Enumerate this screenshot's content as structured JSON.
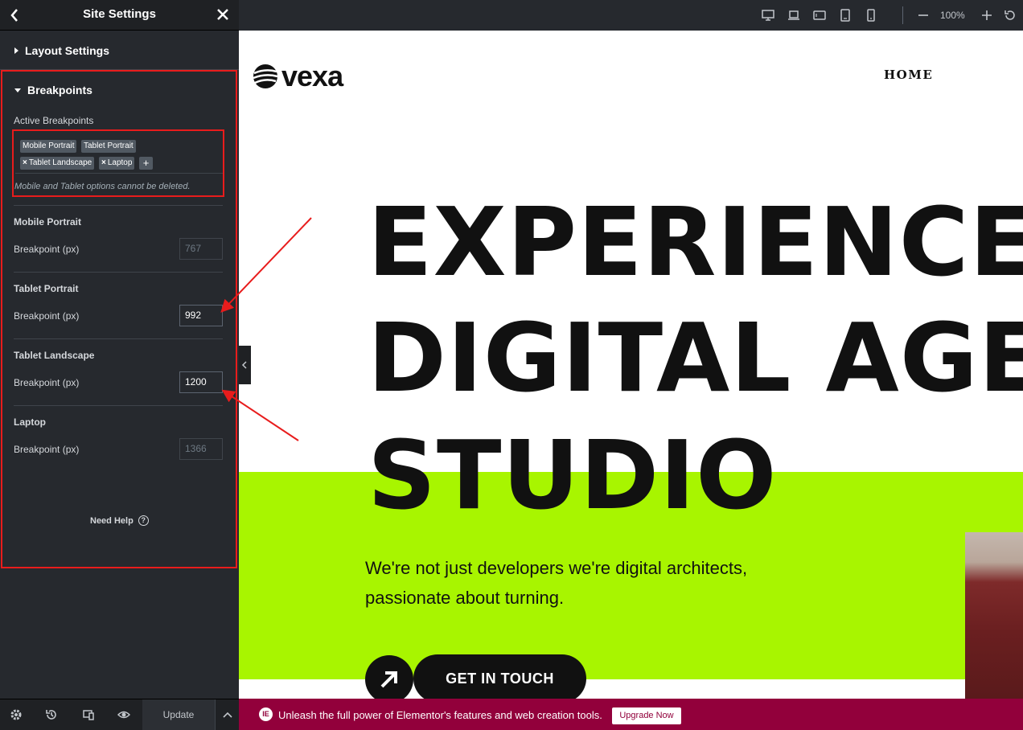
{
  "panel": {
    "title": "Site Settings",
    "layout_section": "Layout Settings",
    "breakpoints_section": "Breakpoints",
    "active_label": "Active Breakpoints",
    "tags": [
      "Mobile Portrait",
      "Tablet Portrait",
      "Tablet Landscape",
      "Laptop"
    ],
    "tag_remove_glyph": "×",
    "add_glyph": "+",
    "tags_note": "Mobile and Tablet options cannot be deleted.",
    "breakpoints": [
      {
        "title": "Mobile Portrait",
        "label": "Breakpoint (px)",
        "value": "767"
      },
      {
        "title": "Tablet Portrait",
        "label": "Breakpoint (px)",
        "value": "992"
      },
      {
        "title": "Tablet Landscape",
        "label": "Breakpoint (px)",
        "value": "1200"
      },
      {
        "title": "Laptop",
        "label": "Breakpoint (px)",
        "value": "1366"
      }
    ],
    "need_help": "Need Help",
    "help_glyph": "?",
    "update_label": "Update"
  },
  "topbar": {
    "devices": [
      "desktop-icon",
      "laptop-icon",
      "tablet-landscape-icon",
      "tablet-portrait-icon",
      "mobile-icon"
    ],
    "zoom": "100%"
  },
  "site": {
    "logo": "vexa",
    "nav_home": "HOME",
    "hero_lines": [
      "EXPERIENCE",
      "DIGITAL AGE",
      "STUDIO"
    ],
    "subtext": "We're not just developers we're digital architects, passionate about turning.",
    "cta": "GET IN TOUCH"
  },
  "promo": {
    "icon_text": "IE",
    "text": "Unleash the full power of Elementor's features and web creation tools.",
    "button": "Upgrade Now"
  },
  "colors": {
    "panel_bg": "#26292e",
    "accent_green": "#a8f500",
    "promo_bg": "#92003b",
    "annotation_red": "#e81c1c"
  }
}
